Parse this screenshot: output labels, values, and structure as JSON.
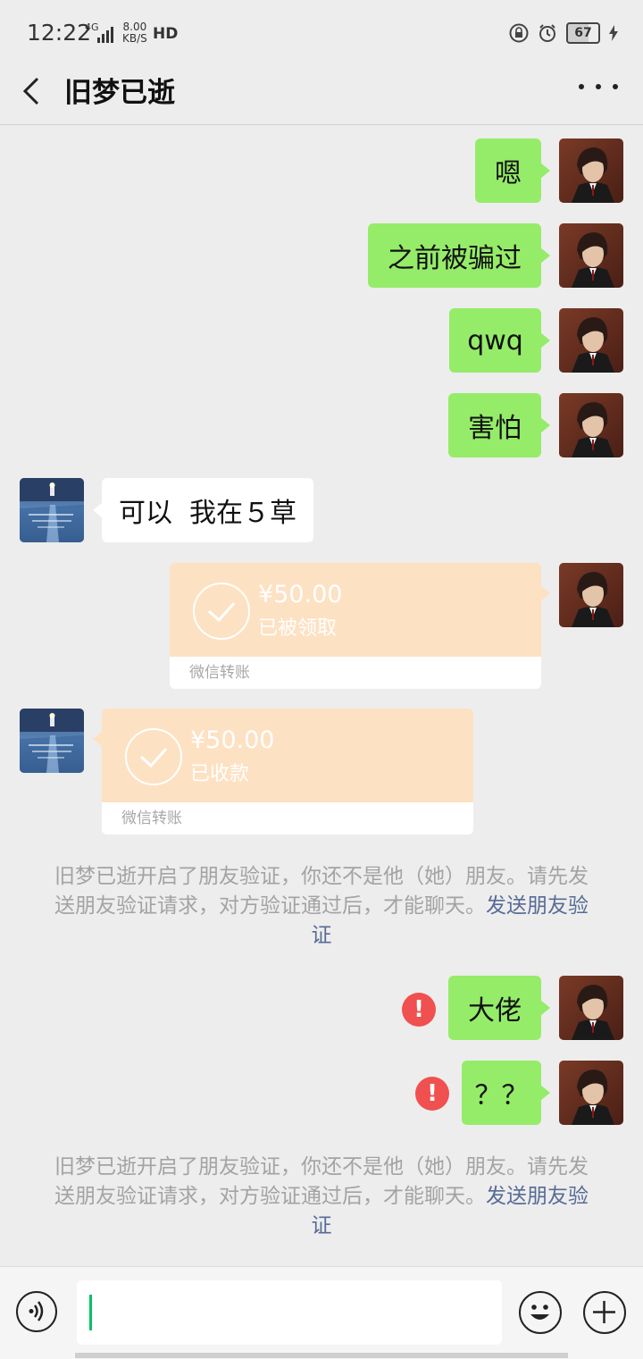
{
  "status_bar": {
    "time": "12:22",
    "network_type": "4G",
    "net_speed_value": "8.00",
    "net_speed_unit": "KB/S",
    "hd_label": "HD",
    "battery_level": "67",
    "icons": [
      "signal-icon",
      "hd-call-icon",
      "lock-rotation-icon",
      "alarm-icon",
      "battery-icon",
      "charging-icon"
    ]
  },
  "header": {
    "title": "旧梦已逝",
    "back_icon": "chevron-left-icon",
    "more_icon": "more-dots-icon"
  },
  "messages": [
    {
      "from": "me",
      "type": "text",
      "text": "嗯"
    },
    {
      "from": "me",
      "type": "text",
      "text": "之前被骗过"
    },
    {
      "from": "me",
      "type": "text",
      "text": "qwq"
    },
    {
      "from": "me",
      "type": "text",
      "text": "害怕"
    },
    {
      "from": "other",
      "type": "text",
      "text": "可以  我在５草"
    },
    {
      "from": "me",
      "type": "transfer",
      "amount": "¥50.00",
      "status": "已被领取",
      "label": "微信转账"
    },
    {
      "from": "other",
      "type": "transfer",
      "amount": "¥50.00",
      "status": "已收款",
      "label": "微信转账"
    },
    {
      "type": "system",
      "text": "旧梦已逝开启了朋友验证，你还不是他（她）朋友。请先发送朋友验证请求，对方验证通过后，才能聊天。",
      "link": "发送朋友验证"
    },
    {
      "from": "me",
      "type": "text",
      "text": "大佬",
      "failed": true
    },
    {
      "from": "me",
      "type": "text",
      "text": "？？",
      "failed": true
    },
    {
      "type": "system",
      "text": "旧梦已逝开启了朋友验证，你还不是他（她）朋友。请先发送朋友验证请求，对方验证通过后，才能聊天。",
      "link": "发送朋友验证"
    }
  ],
  "input_bar": {
    "value": "",
    "icons": [
      "voice-icon",
      "emoji-icon",
      "plus-icon"
    ]
  },
  "colors": {
    "my_bubble": "#95ec69",
    "other_bubble": "#ffffff",
    "transfer_top": "#fde1c3",
    "link": "#576b95",
    "error": "#f0504f",
    "background": "#ededed"
  }
}
